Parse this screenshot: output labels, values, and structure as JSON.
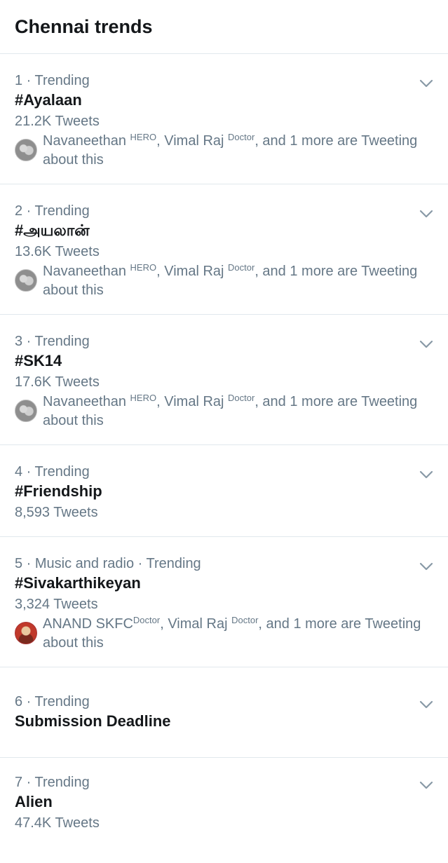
{
  "header": {
    "title": "Chennai trends"
  },
  "trends": [
    {
      "meta": "1 · Trending",
      "name": "#Ayalaan",
      "count": "21.2K Tweets",
      "social": {
        "user1": "Navaneethan",
        "badge1": "HERO",
        "sep1": ", ",
        "user2": "Vimal Raj",
        "badge2": "Doctor",
        "rest": ", and 1 more are Tweeting about this"
      }
    },
    {
      "meta": "2 · Trending",
      "name": "#அயலான்",
      "count": "13.6K Tweets",
      "social": {
        "user1": "Navaneethan",
        "badge1": "HERO",
        "sep1": ", ",
        "user2": "Vimal Raj",
        "badge2": "Doctor",
        "rest": ", and 1 more are Tweeting about this"
      }
    },
    {
      "meta": "3 · Trending",
      "name": "#SK14",
      "count": "17.6K Tweets",
      "social": {
        "user1": "Navaneethan",
        "badge1": "HERO",
        "sep1": ", ",
        "user2": "Vimal Raj",
        "badge2": "Doctor",
        "rest": ", and 1 more are Tweeting about this"
      }
    },
    {
      "meta": "4 · Trending",
      "name": "#Friendship",
      "count": "8,593 Tweets"
    },
    {
      "meta": "5 · Music and radio · Trending",
      "name": "#Sivakarthikeyan",
      "count": "3,324 Tweets",
      "social": {
        "user1": "ANAND SKFC",
        "badge1": "Doctor",
        "sep1": ", ",
        "user2": "Vimal Raj",
        "badge2": "Doctor",
        "rest": ", and 1 more are Tweeting about this"
      }
    },
    {
      "meta": "6 · Trending",
      "name": "Submission Deadline"
    },
    {
      "meta": "7 · Trending",
      "name": "Alien",
      "count": "47.4K Tweets"
    }
  ],
  "colors": {
    "secondary_text": "#657786",
    "primary_text": "#14171a",
    "divider": "#e1e8ed",
    "chevron": "#8899a6"
  }
}
